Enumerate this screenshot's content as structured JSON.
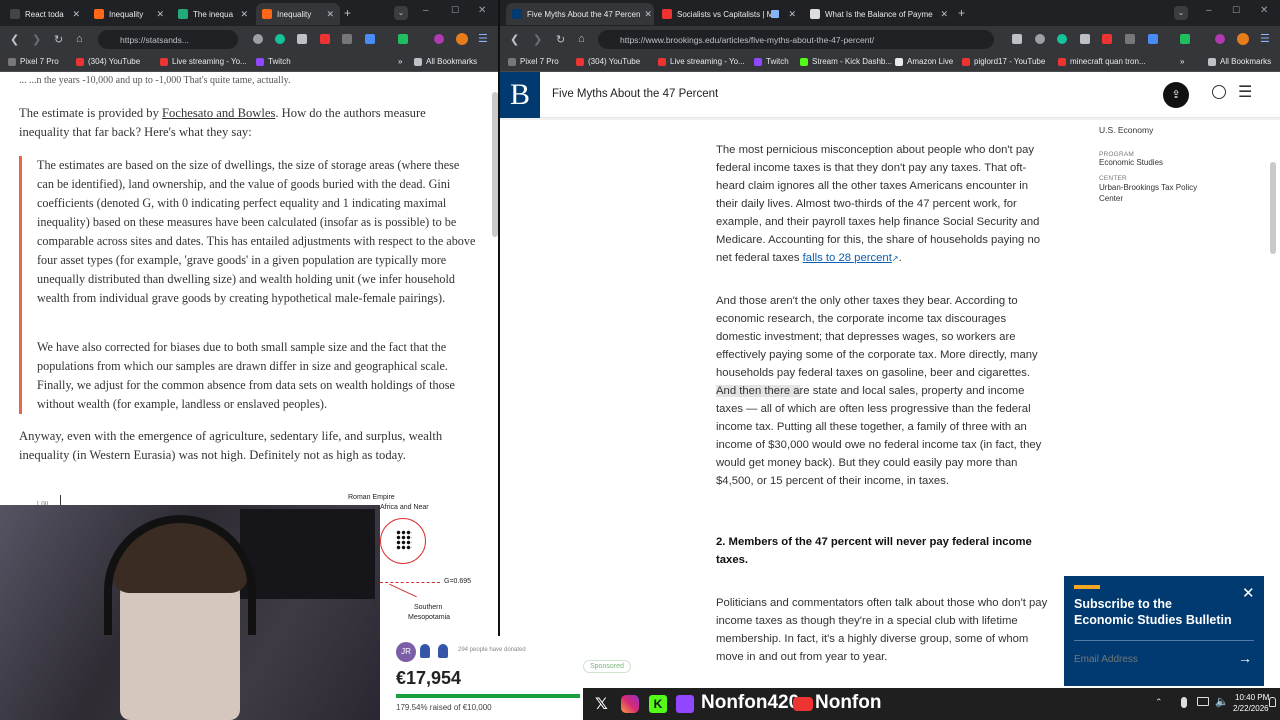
{
  "left_window": {
    "tabs": [
      {
        "label": "React toda"
      },
      {
        "label": "Inequality"
      },
      {
        "label": "The inequa"
      },
      {
        "label": "Inequality"
      }
    ],
    "url": "https://statsands...",
    "bookmarks": [
      {
        "label": "Pixel 7 Pro"
      },
      {
        "label": "(304) YouTube"
      },
      {
        "label": "Live streaming - Yo..."
      },
      {
        "label": "Twitch"
      }
    ],
    "all_bookmarks": "All Bookmarks",
    "article": {
      "top_cut": "... ...n the years -10,000 and up to -1,000 That's quite tame, actually.",
      "p1_before": "The estimate is provided by ",
      "p1_link": "Fochesato and Bowles",
      "p1_after": ". How do the authors measure inequality that far back? Here's what they say:",
      "quote1": "The estimates are based on the size of dwellings, the size of storage areas (where these can be identified), land ownership, and the value of goods buried with the dead. Gini coefficients (denoted G, with 0 indicating perfect equality and 1 indicating maximal inequality) based on these measures have been calculated (insofar as is possible) to be comparable across sites and dates. This has entailed adjustments with respect to the above four asset types (for example, 'grave goods' in a given population are typically more unequally distributed than dwelling size) and wealth holding unit (we infer household wealth from individual grave goods by creating hypothetical male-female pairings).",
      "quote2": "We have also corrected for biases due to both small sample size and the fact that the populations from which our samples are drawn differ in size and geographical scale. Finally, we adjust for the common absence from data sets on wealth holdings of those without wealth (for example, landless or enslaved peoples).",
      "p2": "Anyway, even with the emergence of agriculture, sedentary life, and surplus, wealth inequality (in Western Eurasia) was not high. Definitely not as high as today.",
      "figure": {
        "label_roman": "Roman Empire",
        "label_roman2": "Africa and Near",
        "label_g": "G=0.695",
        "label_south": "Southern",
        "label_meso": "Mesopotamia",
        "axis_tick": "1.00"
      }
    }
  },
  "right_window": {
    "tabs": [
      {
        "label": "Five Myths About the 47 Percen"
      },
      {
        "label": "Socialists vs Capitalists | M"
      },
      {
        "label": "What Is the Balance of Payme"
      }
    ],
    "url": "https://www.brookings.edu/articles/five-myths-about-the-47-percent/",
    "bookmarks": [
      {
        "label": "Pixel 7 Pro"
      },
      {
        "label": "(304) YouTube"
      },
      {
        "label": "Live streaming - Yo..."
      },
      {
        "label": "Twitch"
      },
      {
        "label": "Stream - Kick Dashb..."
      },
      {
        "label": "Amazon Live"
      },
      {
        "label": "piglord17 - YouTube"
      },
      {
        "label": "minecraft quan tron..."
      }
    ],
    "all_bookmarks": "All Bookmarks",
    "site_logo": "B",
    "page_title": "Five Myths About the 47 Percent",
    "article": {
      "p1_before": "The most pernicious misconception about people who don't pay federal income taxes is that they don't pay any taxes. That oft-heard claim ignores all the other taxes Americans encounter in their daily lives. Almost two-thirds of the 47 percent work, for example, and their payroll taxes help finance Social Security and Medicare. Accounting for this, the share of households paying no net federal taxes ",
      "p1_link": "falls to 28 percent",
      "p1_after": ".",
      "p2_before": "And those aren't the only other taxes they bear. According to economic research, the corporate income tax discourages domestic investment; that depresses wages, so workers are effectively paying some of the corporate tax. More directly, many households pay federal taxes on gasoline, beer and cigarettes. ",
      "p2_highlight": "And then there a",
      "p2_after": "re state and local sales, property and income taxes — all of which are often less progressive than the federal income tax. Putting all these together, a family of three with an income of $30,000 would owe no federal income tax (in fact, they would get money back). But they could easily pay more than $4,500, or 15 percent of their income, in taxes.",
      "heading2": "2. Members of the 47 percent will never pay federal income taxes.",
      "p3": "Politicians and commentators often talk about those who don't pay income taxes as though they're in a special club with lifetime membership. In fact, it's a highly diverse group, some of whom move in and out from year to year."
    },
    "sidebar": {
      "topic": "U.S. Economy",
      "program_label": "PROGRAM",
      "program": "Economic Studies",
      "center_label": "CENTER",
      "center": "Urban-Brookings Tax Policy Center"
    },
    "popup": {
      "title": "Subscribe to the Economic Studies Bulletin",
      "placeholder": "Email Address"
    }
  },
  "overlay": {
    "donation": {
      "avatar": "JR",
      "people": "294 people have donated",
      "amount": "€17,954",
      "raised": "179.54% raised of €10,000",
      "progress": 1.0
    },
    "sponsored": "Sponsored",
    "social_name": "Nonfon420",
    "youtube_name": "Nonfon"
  },
  "taskbar": {
    "time": "10:40 PM",
    "date": "2/22/2026"
  },
  "colors": {
    "brookings_blue": "#003a70",
    "quote_border": "#e8664a",
    "link_blue": "#0b5fb5",
    "popup_accent": "#f5a623"
  }
}
